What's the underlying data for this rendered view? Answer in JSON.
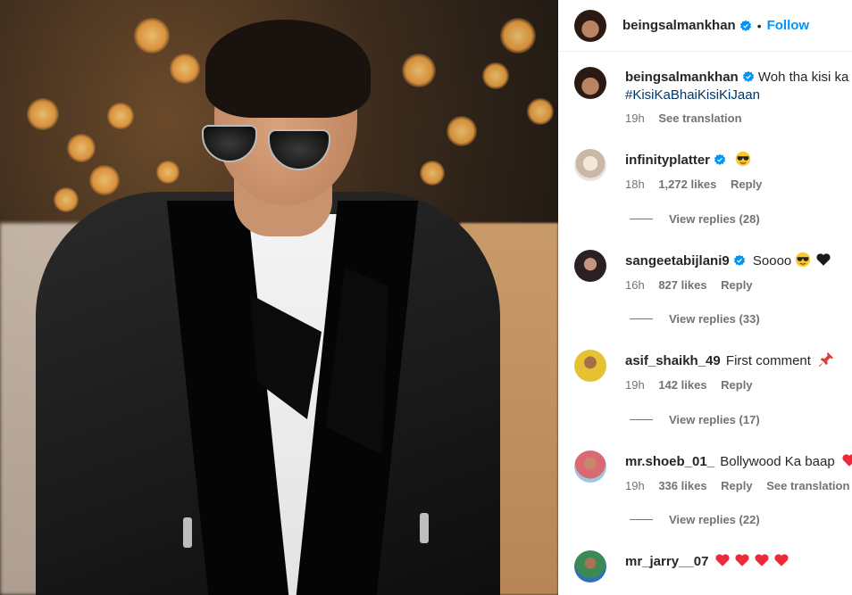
{
  "header": {
    "username": "beingsalmankhan",
    "separator": "•",
    "follow_label": "Follow"
  },
  "caption": {
    "username": "beingsalmankhan",
    "text": "Woh tha kisi ka",
    "hashtag": "#KisiKaBhaiKisiKiJaan",
    "time": "19h",
    "see_translation": "See translation"
  },
  "comments": [
    {
      "username": "infinityplatter",
      "verified": true,
      "text": "",
      "emoji": [
        "sunglasses-emoji"
      ],
      "time": "18h",
      "likes": "1,272 likes",
      "reply": "Reply",
      "view_replies": "View replies (28)"
    },
    {
      "username": "sangeetabijlani9",
      "verified": true,
      "text": "Soooo",
      "emoji": [
        "sunglasses-emoji",
        "black-heart-emoji"
      ],
      "time": "16h",
      "likes": "827 likes",
      "reply": "Reply",
      "view_replies": "View replies (33)"
    },
    {
      "username": "asif_shaikh_49",
      "verified": false,
      "text": "First comment",
      "emoji": [
        "pushpin-emoji"
      ],
      "time": "19h",
      "likes": "142 likes",
      "reply": "Reply",
      "view_replies": "View replies (17)"
    },
    {
      "username": "mr.shoeb_01_",
      "verified": false,
      "text": "Bollywood Ka baap",
      "emoji": [
        "red-heart-emoji"
      ],
      "time": "19h",
      "likes": "336 likes",
      "reply": "Reply",
      "see_translation": "See translation",
      "view_replies": "View replies (22)"
    },
    {
      "username": "mr_jarry__07",
      "verified": false,
      "text": "",
      "emoji": [
        "red-heart-emoji",
        "red-heart-emoji",
        "red-heart-emoji",
        "red-heart-emoji"
      ]
    }
  ],
  "colors": {
    "link_blue": "#0095f6",
    "hashtag": "#00376b",
    "muted": "#737373",
    "heart": "#ed2a3a"
  }
}
